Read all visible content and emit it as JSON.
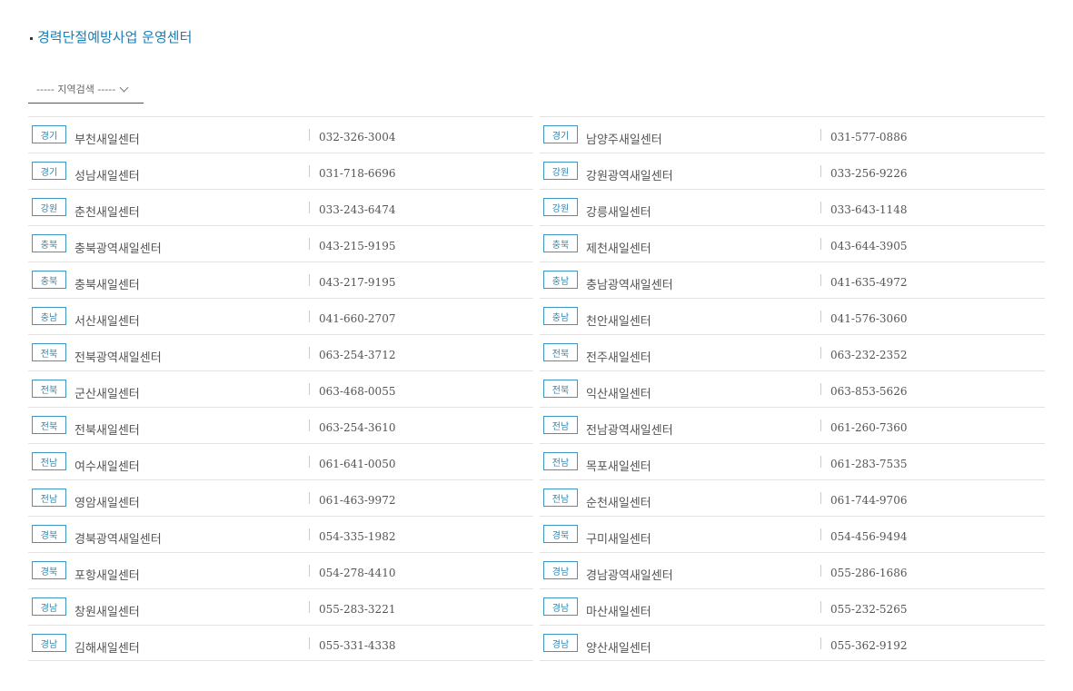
{
  "page_title": "경력단절예방사업 운영센터",
  "region_select": {
    "label": "----- 지역검색 -----"
  },
  "centers_left": [
    {
      "region": "경기",
      "name": "부천새일센터",
      "phone": "032-326-3004"
    },
    {
      "region": "경기",
      "name": "성남새일센터",
      "phone": "031-718-6696"
    },
    {
      "region": "강원",
      "name": "춘천새일센터",
      "phone": "033-243-6474"
    },
    {
      "region": "충북",
      "name": "충북광역새일센터",
      "phone": "043-215-9195"
    },
    {
      "region": "충북",
      "name": "충북새일센터",
      "phone": "043-217-9195"
    },
    {
      "region": "충남",
      "name": "서산새일센터",
      "phone": "041-660-2707"
    },
    {
      "region": "전북",
      "name": "전북광역새일센터",
      "phone": "063-254-3712"
    },
    {
      "region": "전북",
      "name": "군산새일센터",
      "phone": "063-468-0055"
    },
    {
      "region": "전북",
      "name": "전북새일센터",
      "phone": "063-254-3610"
    },
    {
      "region": "전남",
      "name": "여수새일센터",
      "phone": "061-641-0050"
    },
    {
      "region": "전남",
      "name": "영암새일센터",
      "phone": "061-463-9972"
    },
    {
      "region": "경북",
      "name": "경북광역새일센터",
      "phone": "054-335-1982"
    },
    {
      "region": "경북",
      "name": "포항새일센터",
      "phone": "054-278-4410"
    },
    {
      "region": "경남",
      "name": "창원새일센터",
      "phone": "055-283-3221"
    },
    {
      "region": "경남",
      "name": "김해새일센터",
      "phone": "055-331-4338"
    }
  ],
  "centers_right": [
    {
      "region": "경기",
      "name": "남양주새일센터",
      "phone": "031-577-0886"
    },
    {
      "region": "강원",
      "name": "강원광역새일센터",
      "phone": "033-256-9226"
    },
    {
      "region": "강원",
      "name": "강릉새일센터",
      "phone": "033-643-1148"
    },
    {
      "region": "충북",
      "name": "제천새일센터",
      "phone": "043-644-3905"
    },
    {
      "region": "충남",
      "name": "충남광역새일센터",
      "phone": "041-635-4972"
    },
    {
      "region": "충남",
      "name": "천안새일센터",
      "phone": "041-576-3060"
    },
    {
      "region": "전북",
      "name": "전주새일센터",
      "phone": "063-232-2352"
    },
    {
      "region": "전북",
      "name": "익산새일센터",
      "phone": "063-853-5626"
    },
    {
      "region": "전남",
      "name": "전남광역새일센터",
      "phone": "061-260-7360"
    },
    {
      "region": "전남",
      "name": "목포새일센터",
      "phone": "061-283-7535"
    },
    {
      "region": "전남",
      "name": "순천새일센터",
      "phone": "061-744-9706"
    },
    {
      "region": "경북",
      "name": "구미새일센터",
      "phone": "054-456-9494"
    },
    {
      "region": "경남",
      "name": "경남광역새일센터",
      "phone": "055-286-1686"
    },
    {
      "region": "경남",
      "name": "마산새일센터",
      "phone": "055-232-5265"
    },
    {
      "region": "경남",
      "name": "양산새일센터",
      "phone": "055-362-9192"
    }
  ],
  "colors": {
    "accent": "#1a7fb5",
    "badge_border": "#3d97c2",
    "divider": "#e3e3e3"
  }
}
